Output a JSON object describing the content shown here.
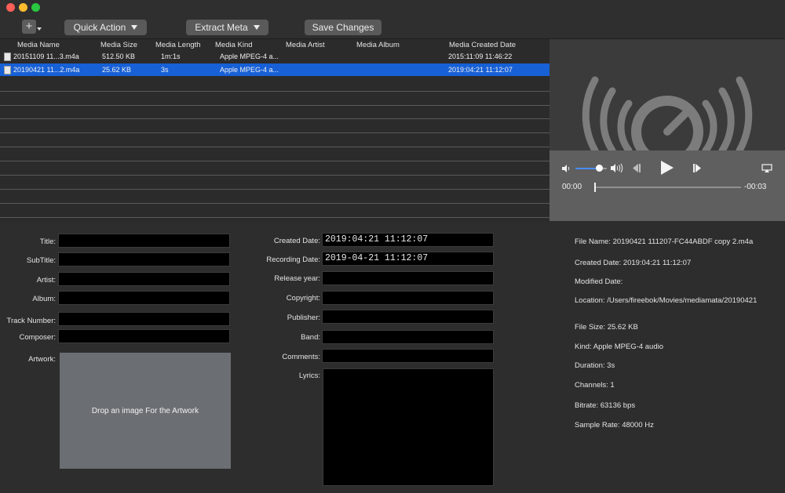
{
  "toolbar": {
    "add_glyph": "+",
    "quick_action_label": "Quick Action",
    "extract_meta_label": "Extract Meta",
    "save_changes_label": "Save Changes"
  },
  "table": {
    "columns": [
      "Media Name",
      "Media Size",
      "Media Length",
      "Media Kind",
      "Media Artist",
      "Media Album",
      "Media Created Date"
    ],
    "rows": [
      {
        "name": "20151109 11...3.m4a",
        "size": "512.50 KB",
        "length": "1m:1s",
        "kind": "Apple MPEG-4 a...",
        "artist": "",
        "album": "",
        "created": "2015:11:09 11:46:22",
        "selected": false
      },
      {
        "name": "20190421 11...2.m4a",
        "size": "25.62 KB",
        "length": "3s",
        "kind": "Apple MPEG-4 a...",
        "artist": "",
        "album": "",
        "created": "2019:04:21 11:12:07",
        "selected": true
      }
    ]
  },
  "player": {
    "elapsed": "00:00",
    "remaining": "-00:03",
    "volume_level": 0.75,
    "playback_progress": 0.0
  },
  "form_left": {
    "title_label": "Title:",
    "title_value": "",
    "subtitle_label": "SubTitle:",
    "subtitle_value": "",
    "artist_label": "Artist:",
    "artist_value": "",
    "album_label": "Album:",
    "album_value": "",
    "track_label": "Track Number:",
    "track_value": "",
    "composer_label": "Composer:",
    "composer_value": "",
    "artwork_label": "Artwork:",
    "artwork_drop_text": "Drop an image For the Artwork"
  },
  "form_middle": {
    "created_label": "Created Date:",
    "created_value": "2019:04:21 11:12:07",
    "recording_label": "Recording Date:",
    "recording_value": "2019-04-21 11:12:07",
    "release_label": "Release year:",
    "release_value": "",
    "copyright_label": "Copyright:",
    "copyright_value": "",
    "publisher_label": "Publisher:",
    "publisher_value": "",
    "band_label": "Band:",
    "band_value": "",
    "comments_label": "Comments:",
    "comments_value": "",
    "lyrics_label": "Lyrics:"
  },
  "info": {
    "file_name": "File Name: 20190421 111207-FC44ABDF copy 2.m4a",
    "created_date": "Created Date: 2019:04:21 11:12:07",
    "modified_date": "Modified Date:",
    "location": "Location: /Users/fireebok/Movies/mediamata/20190421",
    "file_size": "File Size: 25.62 KB",
    "kind": "Kind: Apple MPEG-4 audio",
    "duration": "Duration: 3s",
    "channels": "Channels: 1",
    "bitrate": "Bitrate: 63136 bps",
    "sample_rate": "Sample Rate: 48000 Hz"
  },
  "colors": {
    "selection": "#1760d6",
    "window_bg": "#2b2b2b",
    "field_bg": "#000000",
    "artwork_bg": "#6b6e73"
  },
  "icons": [
    "add-icon",
    "chevron-down-icon",
    "file-icon",
    "quicktime-logo-icon",
    "volume-low-icon",
    "volume-high-icon",
    "skip-back-icon",
    "play-icon",
    "skip-forward-icon",
    "airplay-icon"
  ]
}
